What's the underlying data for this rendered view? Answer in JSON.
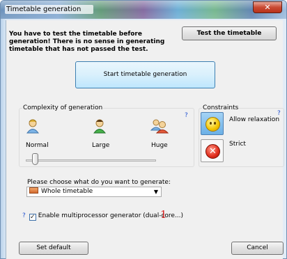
{
  "window": {
    "title": "Timetable generation",
    "close_glyph": "✕"
  },
  "header": {
    "warning": "You have to test the timetable before generation! There is no sense in generating timetable that has not passed the test.",
    "test_button": "Test the timetable"
  },
  "start_button": "Start timetable generation",
  "complexity": {
    "label": "Complexity of generation",
    "help": "?",
    "options": [
      {
        "label": "Normal",
        "icon": "person-single-icon"
      },
      {
        "label": "Large",
        "icon": "person-green-icon"
      },
      {
        "label": "Huge",
        "icon": "people-group-icon"
      }
    ],
    "selected_index": 0
  },
  "constraints": {
    "label": "Constraints",
    "help": "?",
    "relax_label": "Allow relaxation",
    "strict_label": "Strict"
  },
  "generate": {
    "label": "Please choose what do you want to generate:",
    "selected": "Whole timetable"
  },
  "multiprocessor": {
    "help": "?",
    "checked": true,
    "label": "Enable multiprocessor generator (dual-core...)",
    "annotation": "1"
  },
  "footer": {
    "set_default": "Set default",
    "cancel": "Cancel"
  }
}
